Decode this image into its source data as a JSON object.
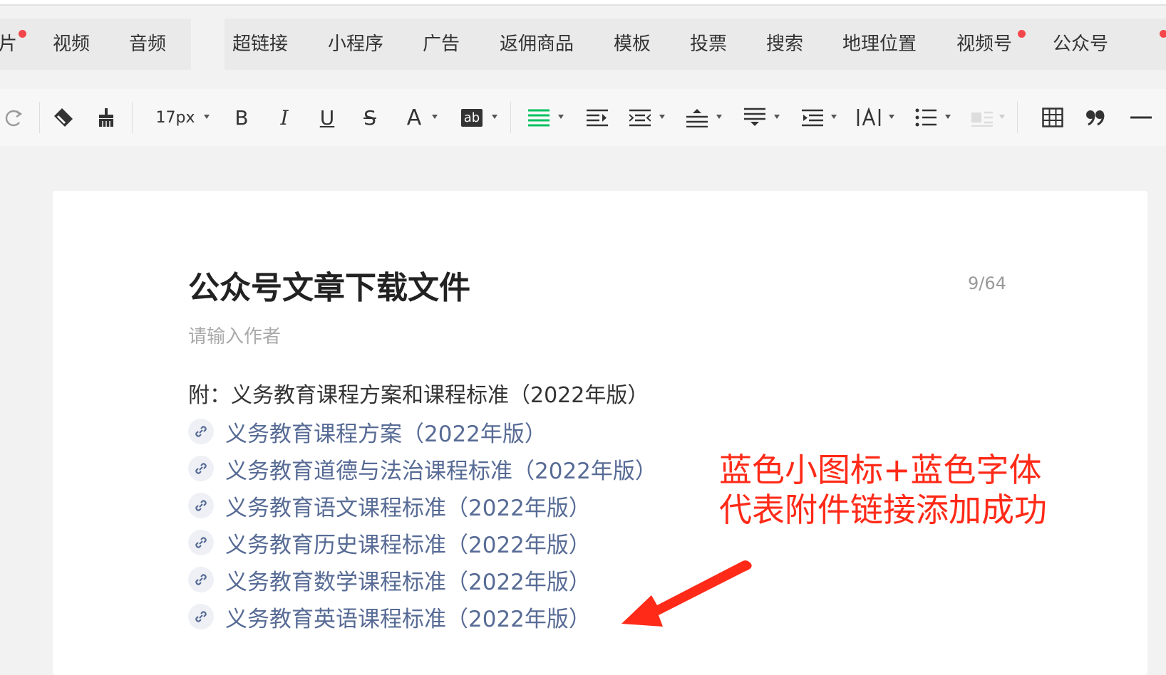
{
  "insert_menu": {
    "group1": [
      {
        "label": "片",
        "has_dot": true
      },
      {
        "label": "视频",
        "has_dot": false
      },
      {
        "label": "音频",
        "has_dot": false
      }
    ],
    "group2": [
      {
        "label": "超链接",
        "has_dot": false
      },
      {
        "label": "小程序",
        "has_dot": false
      },
      {
        "label": "广告",
        "has_dot": false
      },
      {
        "label": "返佣商品",
        "has_dot": false
      },
      {
        "label": "模板",
        "has_dot": false
      },
      {
        "label": "投票",
        "has_dot": false
      },
      {
        "label": "搜索",
        "has_dot": false
      },
      {
        "label": "地理位置",
        "has_dot": false
      },
      {
        "label": "视频号",
        "has_dot": true
      },
      {
        "label": "公众号",
        "has_dot": true
      }
    ]
  },
  "toolbar": {
    "font_size": "17px",
    "bold": "B",
    "italic": "I",
    "underline": "U",
    "strike": "S",
    "font_color": "A",
    "highlight": "ab"
  },
  "editor": {
    "title": "公众号文章下载文件",
    "title_counter": "9/64",
    "author_placeholder": "请输入作者",
    "intro_line": "附：义务教育课程方案和课程标准（2022年版）",
    "attachments": [
      "义务教育课程方案（2022年版）",
      "义务教育道德与法治课程标准（2022年版）",
      "义务教育语文课程标准（2022年版）",
      "义务教育历史课程标准（2022年版）",
      "义务教育数学课程标准（2022年版）",
      "义务教育英语课程标准（2022年版）"
    ]
  },
  "annotation": {
    "line1": "蓝色小图标+蓝色字体",
    "line2": "代表附件链接添加成功"
  },
  "colors": {
    "link": "#576b95",
    "annotation": "#ff2a18",
    "active_align": "#07c160",
    "notify_dot": "#f5474b"
  }
}
